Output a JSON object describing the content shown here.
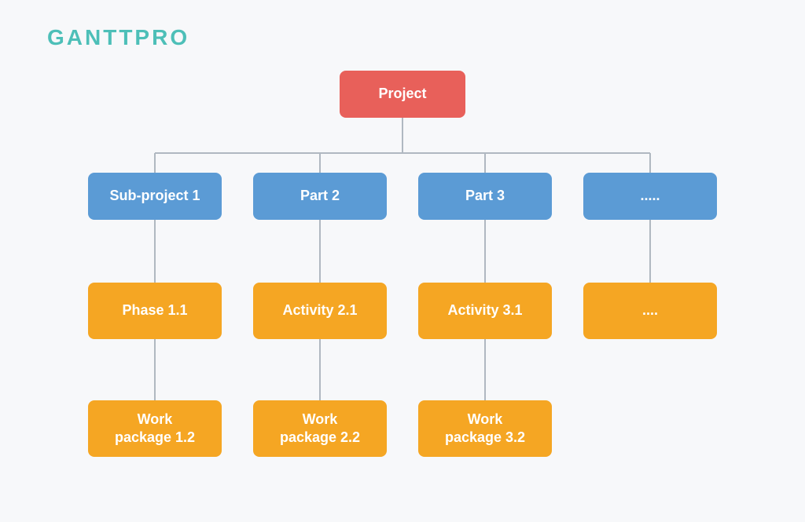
{
  "logo": {
    "text": "GANTTPRO"
  },
  "nodes": {
    "root": "Project",
    "level1": [
      "Sub-project 1",
      "Part 2",
      "Part 3",
      "....."
    ],
    "level2": [
      "Phase 1.1",
      "Activity 2.1",
      "Activity 3.1",
      "...."
    ],
    "level3": [
      "Work\npackage 1.2",
      "Work\npackage 2.2",
      "Work\npackage 3.2",
      ""
    ]
  },
  "colors": {
    "red": "#e8605a",
    "blue": "#5b9bd5",
    "orange": "#f5a623",
    "connector": "#b0b8c1",
    "teal": "#4dbfb8",
    "background": "#f7f8fa"
  }
}
